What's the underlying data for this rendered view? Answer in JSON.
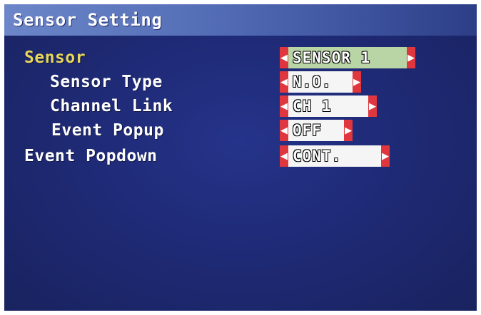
{
  "header": {
    "title": "Sensor Setting"
  },
  "settings": [
    {
      "label": "Sensor",
      "value": "SENSOR 1",
      "selected": true
    },
    {
      "label": "Sensor Type",
      "value": "N.O.",
      "selected": false
    },
    {
      "label": "Channel Link",
      "value": "CH 1",
      "selected": false
    },
    {
      "label": "Event Popup",
      "value": "OFF",
      "selected": false
    },
    {
      "label": "Event Popdown",
      "value": "CONT.",
      "selected": false
    }
  ],
  "icons": {
    "left_arrow": "◀",
    "right_arrow": "▶"
  },
  "colors": {
    "background": "#1e2a6e",
    "title_bar": "#5670b8",
    "selected_label": "#e8d75a",
    "normal_label": "#ffffff",
    "arrow": "#e0363e",
    "selected_value_bg": "#b9d5a5",
    "value_bg": "#f5f5f5"
  }
}
